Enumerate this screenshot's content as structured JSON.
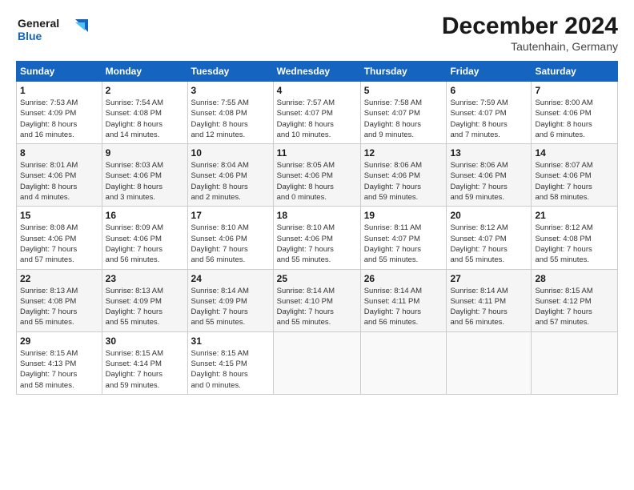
{
  "logo": {
    "line1": "General",
    "line2": "Blue"
  },
  "title": "December 2024",
  "subtitle": "Tautenhain, Germany",
  "days_of_week": [
    "Sunday",
    "Monday",
    "Tuesday",
    "Wednesday",
    "Thursday",
    "Friday",
    "Saturday"
  ],
  "weeks": [
    [
      {
        "day": "1",
        "info": "Sunrise: 7:53 AM\nSunset: 4:09 PM\nDaylight: 8 hours\nand 16 minutes."
      },
      {
        "day": "2",
        "info": "Sunrise: 7:54 AM\nSunset: 4:08 PM\nDaylight: 8 hours\nand 14 minutes."
      },
      {
        "day": "3",
        "info": "Sunrise: 7:55 AM\nSunset: 4:08 PM\nDaylight: 8 hours\nand 12 minutes."
      },
      {
        "day": "4",
        "info": "Sunrise: 7:57 AM\nSunset: 4:07 PM\nDaylight: 8 hours\nand 10 minutes."
      },
      {
        "day": "5",
        "info": "Sunrise: 7:58 AM\nSunset: 4:07 PM\nDaylight: 8 hours\nand 9 minutes."
      },
      {
        "day": "6",
        "info": "Sunrise: 7:59 AM\nSunset: 4:07 PM\nDaylight: 8 hours\nand 7 minutes."
      },
      {
        "day": "7",
        "info": "Sunrise: 8:00 AM\nSunset: 4:06 PM\nDaylight: 8 hours\nand 6 minutes."
      }
    ],
    [
      {
        "day": "8",
        "info": "Sunrise: 8:01 AM\nSunset: 4:06 PM\nDaylight: 8 hours\nand 4 minutes."
      },
      {
        "day": "9",
        "info": "Sunrise: 8:03 AM\nSunset: 4:06 PM\nDaylight: 8 hours\nand 3 minutes."
      },
      {
        "day": "10",
        "info": "Sunrise: 8:04 AM\nSunset: 4:06 PM\nDaylight: 8 hours\nand 2 minutes."
      },
      {
        "day": "11",
        "info": "Sunrise: 8:05 AM\nSunset: 4:06 PM\nDaylight: 8 hours\nand 0 minutes."
      },
      {
        "day": "12",
        "info": "Sunrise: 8:06 AM\nSunset: 4:06 PM\nDaylight: 7 hours\nand 59 minutes."
      },
      {
        "day": "13",
        "info": "Sunrise: 8:06 AM\nSunset: 4:06 PM\nDaylight: 7 hours\nand 59 minutes."
      },
      {
        "day": "14",
        "info": "Sunrise: 8:07 AM\nSunset: 4:06 PM\nDaylight: 7 hours\nand 58 minutes."
      }
    ],
    [
      {
        "day": "15",
        "info": "Sunrise: 8:08 AM\nSunset: 4:06 PM\nDaylight: 7 hours\nand 57 minutes."
      },
      {
        "day": "16",
        "info": "Sunrise: 8:09 AM\nSunset: 4:06 PM\nDaylight: 7 hours\nand 56 minutes."
      },
      {
        "day": "17",
        "info": "Sunrise: 8:10 AM\nSunset: 4:06 PM\nDaylight: 7 hours\nand 56 minutes."
      },
      {
        "day": "18",
        "info": "Sunrise: 8:10 AM\nSunset: 4:06 PM\nDaylight: 7 hours\nand 55 minutes."
      },
      {
        "day": "19",
        "info": "Sunrise: 8:11 AM\nSunset: 4:07 PM\nDaylight: 7 hours\nand 55 minutes."
      },
      {
        "day": "20",
        "info": "Sunrise: 8:12 AM\nSunset: 4:07 PM\nDaylight: 7 hours\nand 55 minutes."
      },
      {
        "day": "21",
        "info": "Sunrise: 8:12 AM\nSunset: 4:08 PM\nDaylight: 7 hours\nand 55 minutes."
      }
    ],
    [
      {
        "day": "22",
        "info": "Sunrise: 8:13 AM\nSunset: 4:08 PM\nDaylight: 7 hours\nand 55 minutes."
      },
      {
        "day": "23",
        "info": "Sunrise: 8:13 AM\nSunset: 4:09 PM\nDaylight: 7 hours\nand 55 minutes."
      },
      {
        "day": "24",
        "info": "Sunrise: 8:14 AM\nSunset: 4:09 PM\nDaylight: 7 hours\nand 55 minutes."
      },
      {
        "day": "25",
        "info": "Sunrise: 8:14 AM\nSunset: 4:10 PM\nDaylight: 7 hours\nand 55 minutes."
      },
      {
        "day": "26",
        "info": "Sunrise: 8:14 AM\nSunset: 4:11 PM\nDaylight: 7 hours\nand 56 minutes."
      },
      {
        "day": "27",
        "info": "Sunrise: 8:14 AM\nSunset: 4:11 PM\nDaylight: 7 hours\nand 56 minutes."
      },
      {
        "day": "28",
        "info": "Sunrise: 8:15 AM\nSunset: 4:12 PM\nDaylight: 7 hours\nand 57 minutes."
      }
    ],
    [
      {
        "day": "29",
        "info": "Sunrise: 8:15 AM\nSunset: 4:13 PM\nDaylight: 7 hours\nand 58 minutes."
      },
      {
        "day": "30",
        "info": "Sunrise: 8:15 AM\nSunset: 4:14 PM\nDaylight: 7 hours\nand 59 minutes."
      },
      {
        "day": "31",
        "info": "Sunrise: 8:15 AM\nSunset: 4:15 PM\nDaylight: 8 hours\nand 0 minutes."
      },
      {
        "day": "",
        "info": ""
      },
      {
        "day": "",
        "info": ""
      },
      {
        "day": "",
        "info": ""
      },
      {
        "day": "",
        "info": ""
      }
    ]
  ]
}
